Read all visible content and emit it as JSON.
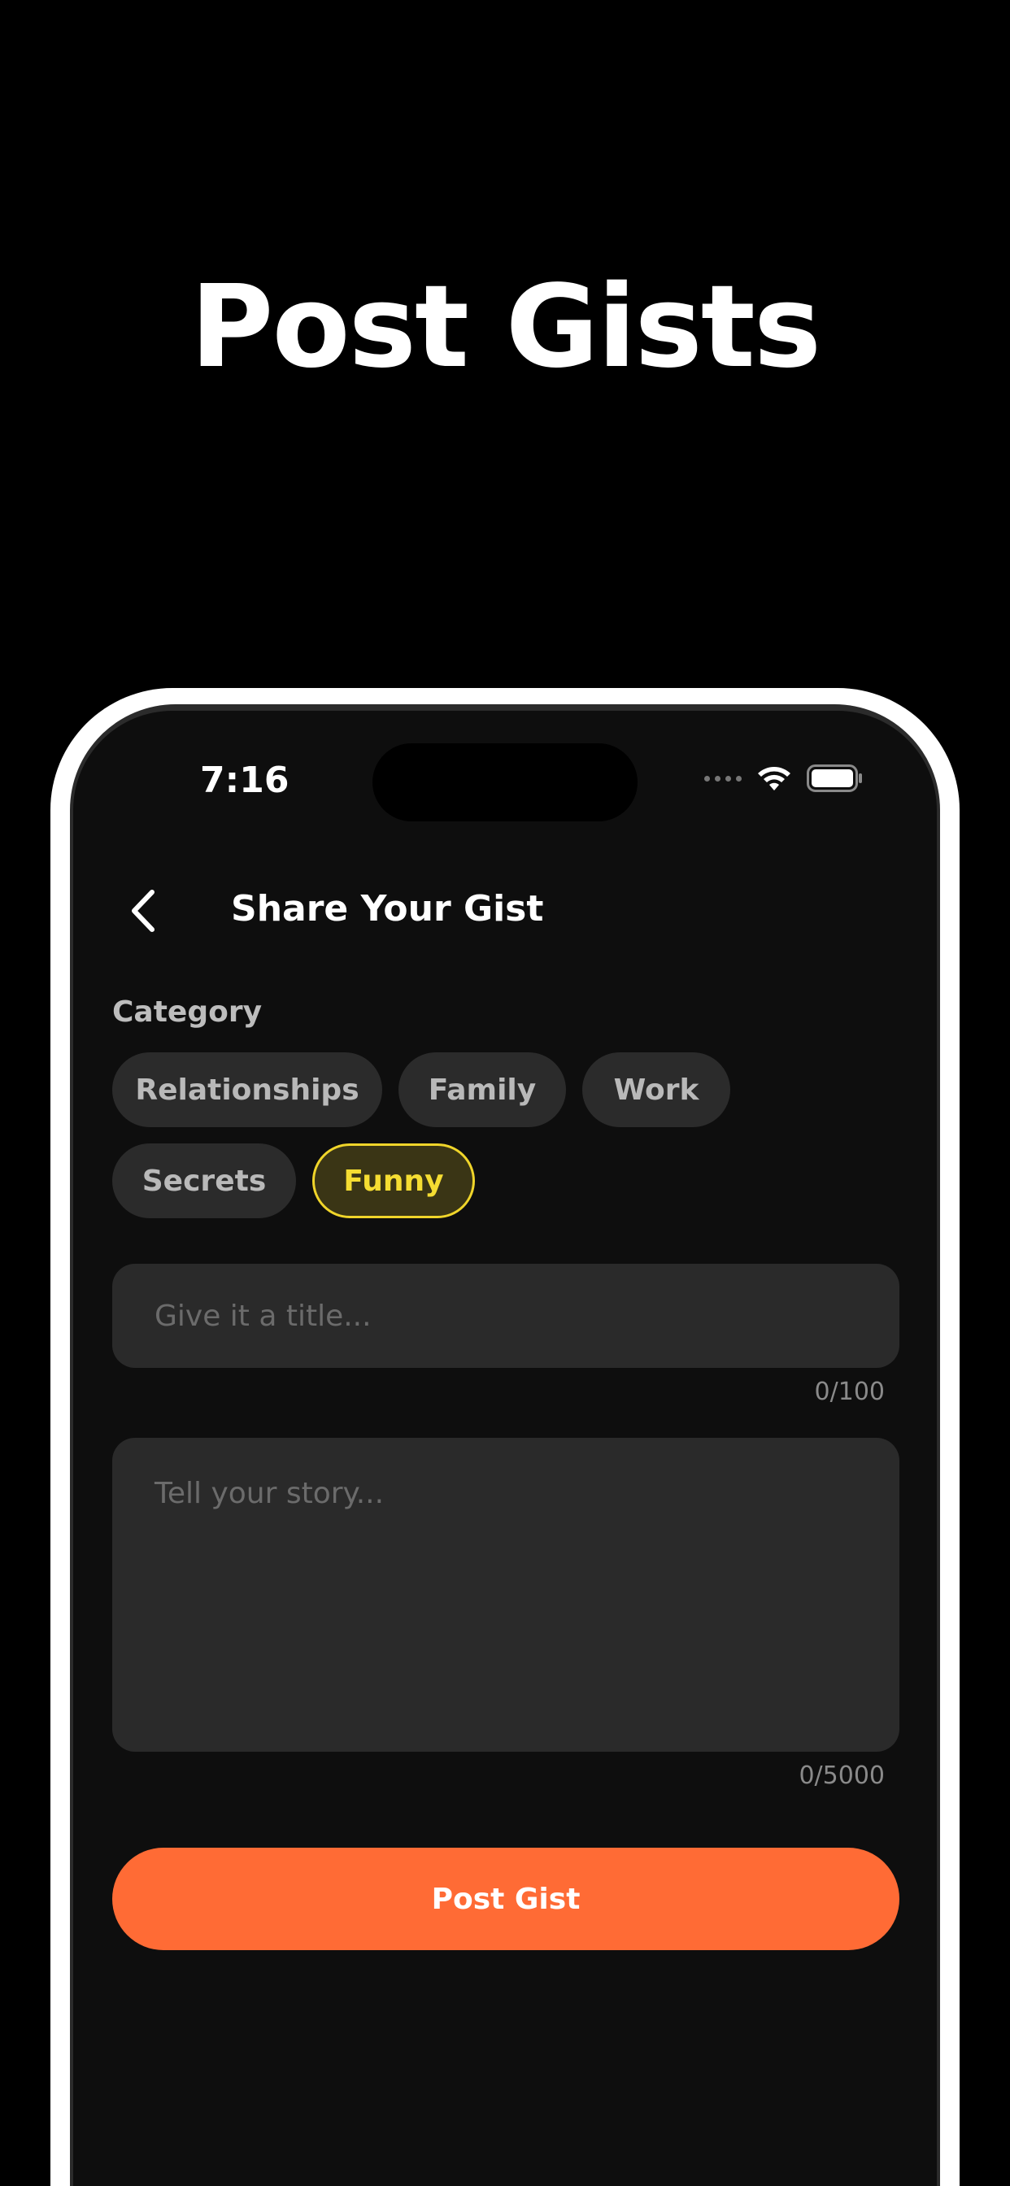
{
  "headline": "Post Gists",
  "status_bar": {
    "time": "7:16",
    "wifi_icon": "wifi-icon",
    "battery_icon": "battery-icon"
  },
  "nav": {
    "back_icon": "chevron-left-icon",
    "title": "Share Your Gist"
  },
  "category": {
    "label": "Category",
    "chips": [
      {
        "label": "Relationships",
        "selected": false
      },
      {
        "label": "Family",
        "selected": false
      },
      {
        "label": "Work",
        "selected": false
      },
      {
        "label": "Secrets",
        "selected": false
      },
      {
        "label": "Funny",
        "selected": true
      }
    ]
  },
  "title_field": {
    "value": "",
    "placeholder": "Give it a title...",
    "counter": "0/100"
  },
  "story_field": {
    "value": "",
    "placeholder": "Tell your story...",
    "counter": "0/5000"
  },
  "post_button": {
    "label": "Post Gist"
  },
  "colors": {
    "accent": "#ff6b35",
    "selected_chip": "#f0d52a",
    "background": "#0e0e0e",
    "field": "#2a2a2a"
  }
}
